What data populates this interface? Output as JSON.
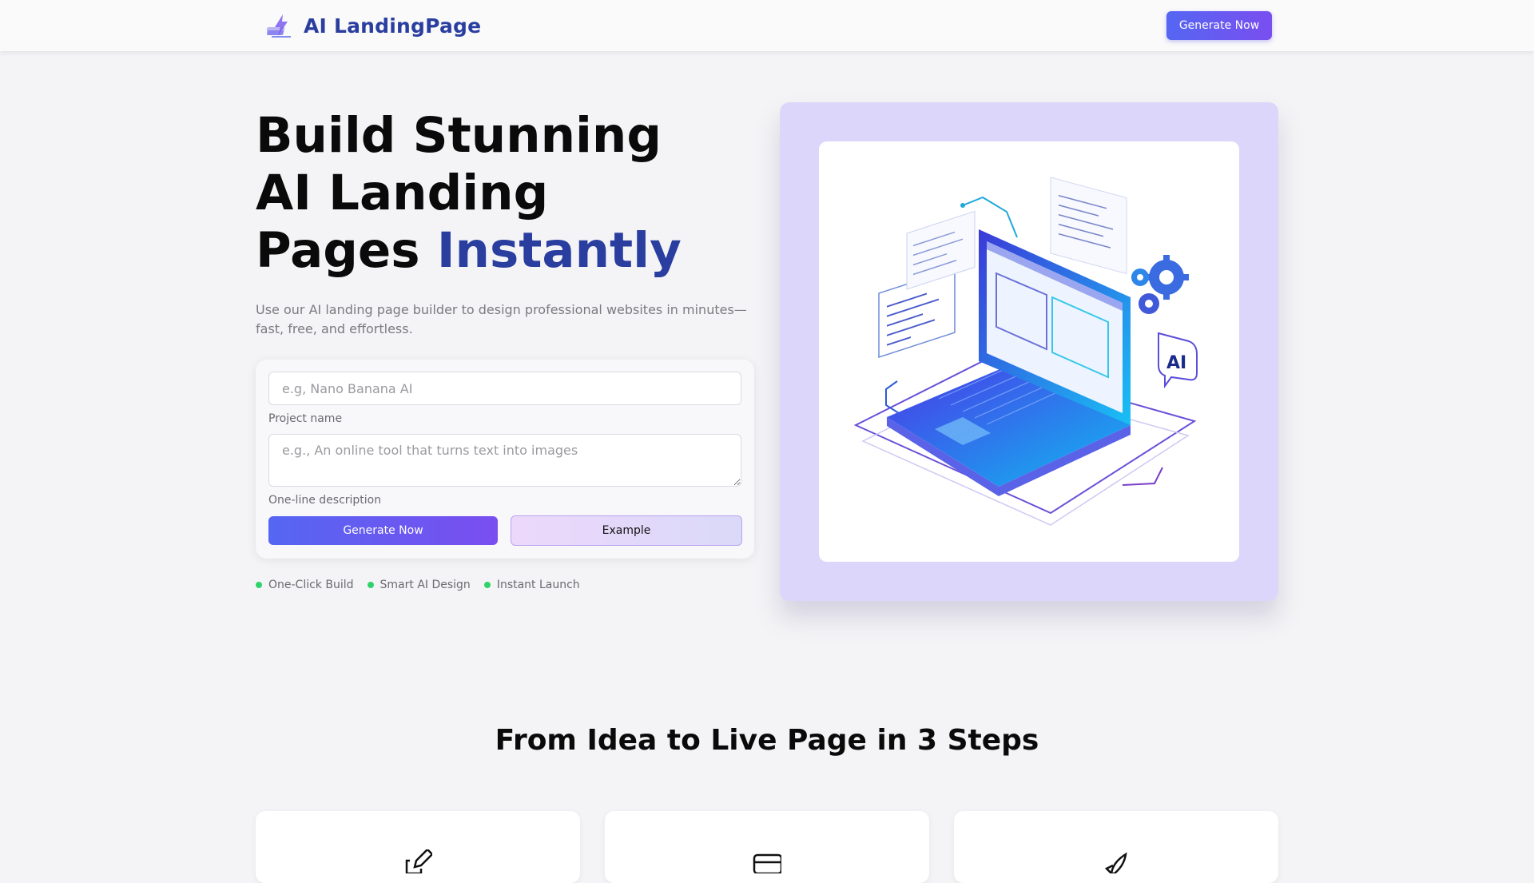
{
  "navbar": {
    "brand_name": "AI LandingPage",
    "cta_label": "Generate Now"
  },
  "hero": {
    "title_line1": "Build Stunning",
    "title_line2": "AI Landing",
    "title_line3_plain": "Pages",
    "title_line3_accent": "Instantly",
    "subtitle": "Use our AI landing page builder to design professional websites in minutes—fast, free, and effortless."
  },
  "form": {
    "name_placeholder": "e.g, Nano Banana AI",
    "name_value": "",
    "name_label": "Project name",
    "desc_placeholder": "e.g., An online tool that turns text into images",
    "desc_value": "",
    "desc_label": "One-line description",
    "generate_label": "Generate Now",
    "example_label": "Example"
  },
  "features": [
    {
      "label": "One-Click Build"
    },
    {
      "label": "Smart AI Design"
    },
    {
      "label": "Instant Launch"
    }
  ],
  "illustration": {
    "screen_badge": "AI"
  },
  "steps_section": {
    "title": "From Idea to Live Page in 3 Steps",
    "cards": [
      {
        "icon": "pencil-icon"
      },
      {
        "icon": "layout-icon"
      },
      {
        "icon": "rocket-icon"
      }
    ]
  },
  "colors": {
    "brand": "#2a3ea0",
    "gradient_start": "#5566f2",
    "gradient_end": "#7a4ef0",
    "feature_dot": "#2fd36a",
    "visual_bg": "#ddd6fb"
  }
}
